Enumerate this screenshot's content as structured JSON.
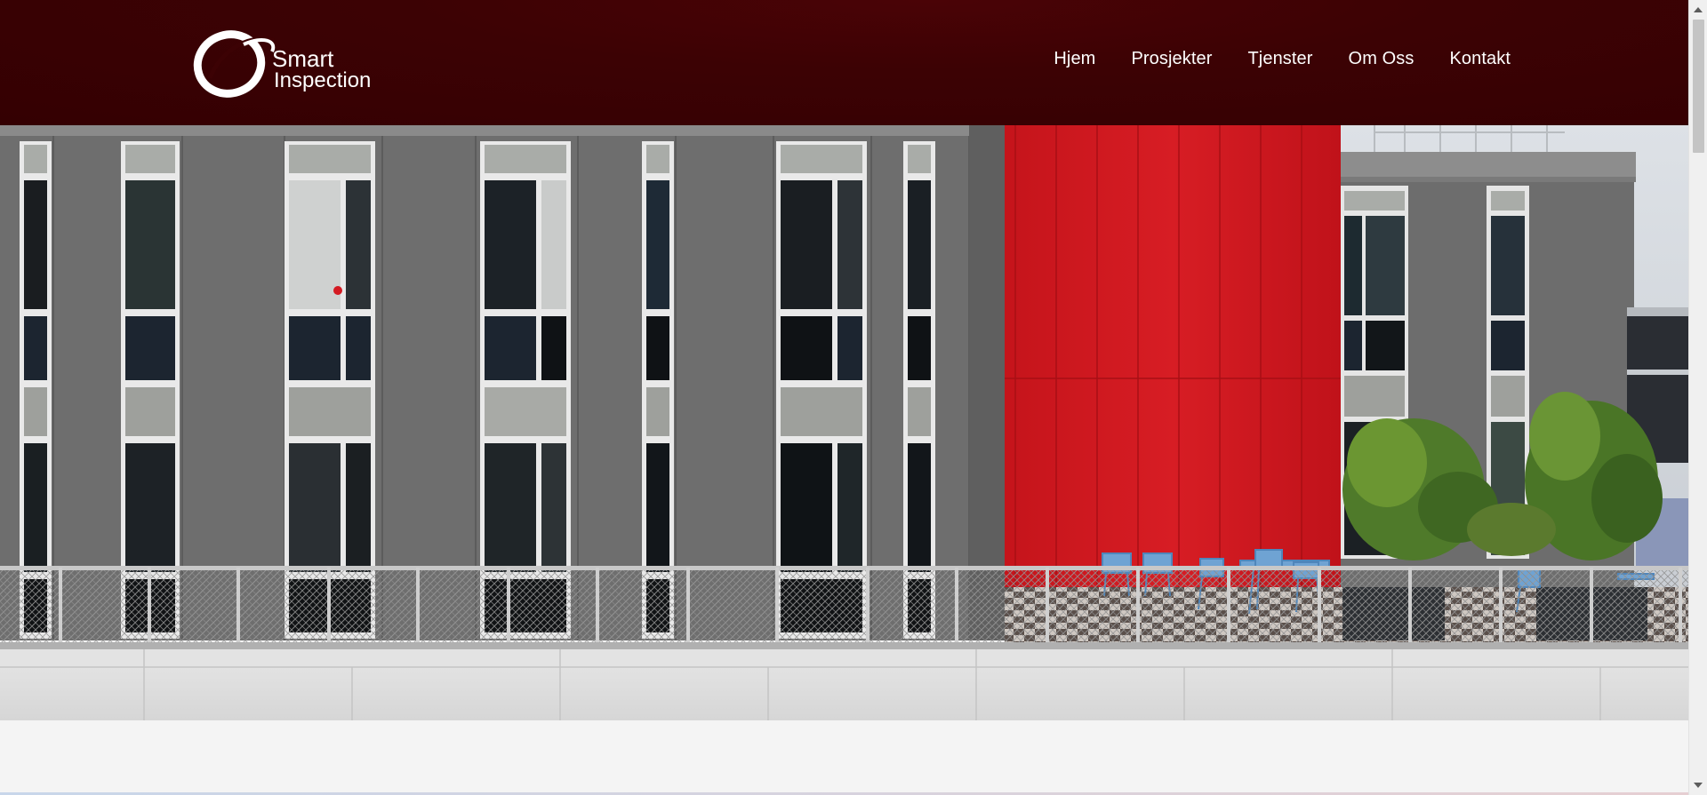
{
  "brand": {
    "logo_line1": "Smart",
    "logo_line2": "Inspection"
  },
  "nav": {
    "items": [
      {
        "label": "Hjem"
      },
      {
        "label": "Prosjekter"
      },
      {
        "label": "Tjenster"
      },
      {
        "label": "Om Oss"
      },
      {
        "label": "Kontakt"
      }
    ]
  },
  "colors": {
    "header_bg": "#3c0204",
    "nav_text": "#ffffff",
    "accent_red": "#d41a22"
  },
  "icons": {
    "scroll_up": "scroll-up-arrow-icon",
    "scroll_down": "scroll-down-arrow-icon"
  }
}
